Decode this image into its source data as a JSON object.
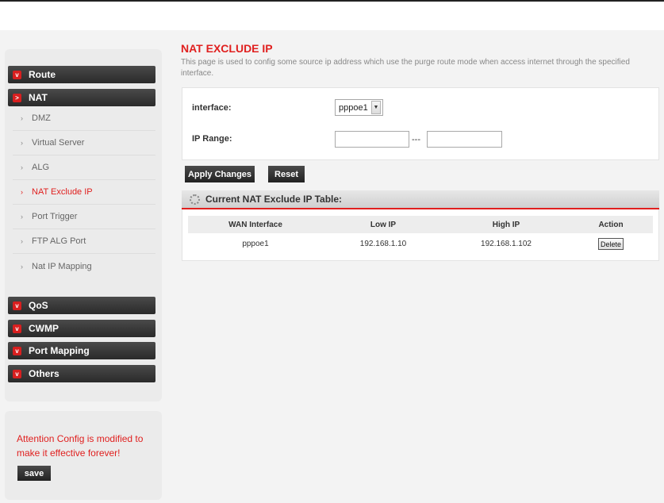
{
  "sidebar": {
    "menus_top": [
      {
        "label": "Route",
        "chev": "v"
      },
      {
        "label": "NAT",
        "chev": ">"
      }
    ],
    "nat_items": [
      {
        "label": "DMZ"
      },
      {
        "label": "Virtual Server"
      },
      {
        "label": "ALG"
      },
      {
        "label": "NAT Exclude IP",
        "active": true
      },
      {
        "label": "Port Trigger"
      },
      {
        "label": "FTP ALG Port"
      },
      {
        "label": "Nat IP Mapping"
      }
    ],
    "menus_bottom": [
      {
        "label": "QoS",
        "chev": "v"
      },
      {
        "label": "CWMP",
        "chev": "v"
      },
      {
        "label": "Port Mapping",
        "chev": "v"
      },
      {
        "label": "Others",
        "chev": "v"
      }
    ],
    "attention_text": "Attention Config is modified to make it effective forever!",
    "save_label": "save"
  },
  "main": {
    "title": "NAT EXCLUDE IP",
    "description": "This page is used to config some source ip address which use the purge route mode when access internet through the specified interface.",
    "interface_label": "interface:",
    "interface_value": "pppoe1",
    "ip_range_label": "IP Range:",
    "range_separator": "---",
    "apply_label": "Apply Changes",
    "reset_label": "Reset",
    "table_title": "Current NAT Exclude IP Table:",
    "columns": [
      "WAN Interface",
      "Low IP",
      "High IP",
      "Action"
    ],
    "rows": [
      {
        "wan": "pppoe1",
        "low": "192.168.1.10",
        "high": "192.168.1.102",
        "action": "Delete"
      }
    ]
  },
  "colors": {
    "accent": "#e0201f",
    "dark_button": "#2a2a2a"
  }
}
